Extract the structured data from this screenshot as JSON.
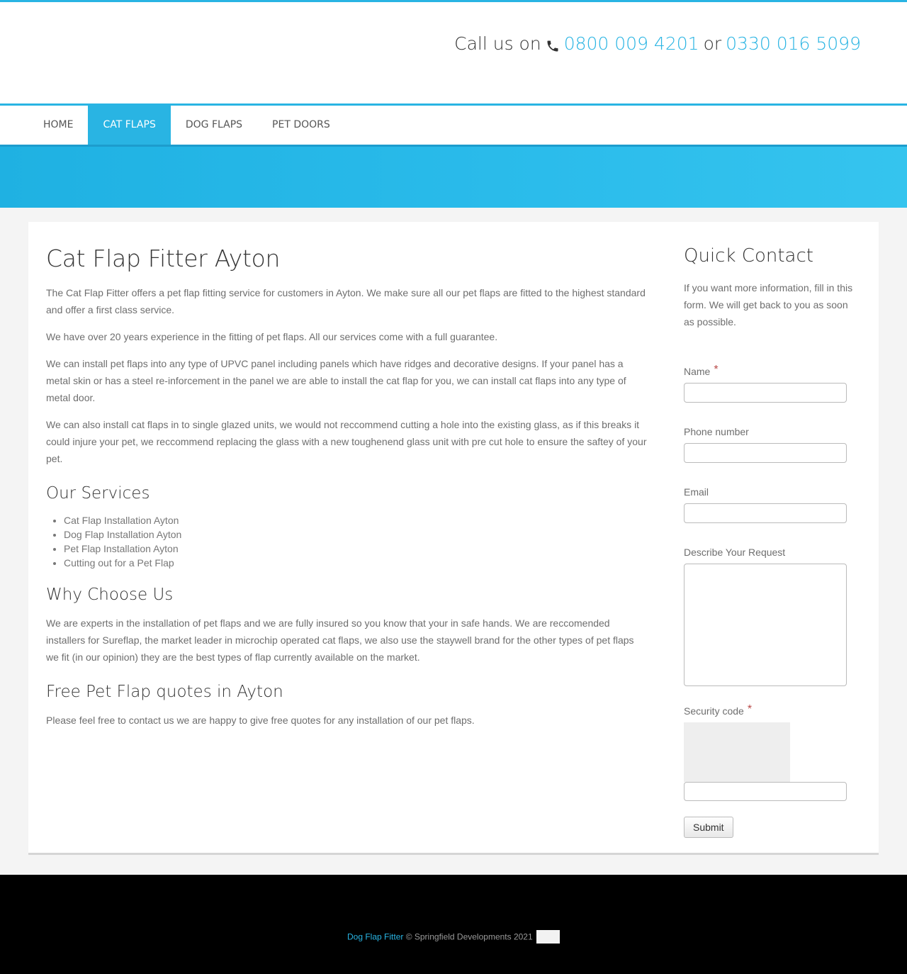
{
  "header": {
    "call_prefix": "Call us on",
    "phone_1": "0800 009 4201",
    "or_text": "or",
    "phone_2": "0330 016 5099",
    "phone_icon": "phone-icon"
  },
  "nav": {
    "items": [
      {
        "label": "HOME",
        "active": false
      },
      {
        "label": "CAT FLAPS",
        "active": true
      },
      {
        "label": "DOG FLAPS",
        "active": false
      },
      {
        "label": "PET DOORS",
        "active": false
      }
    ]
  },
  "colors": {
    "accent": "#29b4e3",
    "footer_bg": "#000000",
    "required_star": "#b94a48"
  },
  "main": {
    "title": "Cat Flap Fitter Ayton",
    "paragraphs": [
      "The Cat Flap Fitter offers a pet flap fitting service for customers in Ayton. We make sure all our pet flaps are fitted to the highest standard and offer a first class service.",
      "We have over 20 years experience in the fitting of pet flaps. All our services come with a full guarantee.",
      "We can install pet flaps into any type of UPVC panel including panels which have ridges and decorative designs. If your panel has a metal skin or has a steel re-inforcement in the panel we are able to install the cat flap for you, we can install cat flaps into any type of metal door.",
      "We can also install cat flaps in to single glazed units, we would not reccommend cutting a hole into the existing glass, as if this breaks it could injure your pet, we reccommend replacing the glass with a new toughenend glass unit with pre cut hole to ensure the saftey of your pet."
    ],
    "services_heading": "Our Services",
    "services": [
      "Cat Flap Installation Ayton",
      "Dog Flap Installation Ayton",
      "Pet Flap Installation Ayton",
      "Cutting out for a Pet Flap"
    ],
    "why_heading": "Why Choose Us",
    "why_text": "We are experts in the installation of pet flaps and we are fully insured so you know that your in safe hands. We are reccomended installers for Sureflap, the market leader in microchip operated cat flaps, we also use the staywell brand for the other types of pet flaps we fit (in our opinion) they are the best types of flap currently available on the market.",
    "quotes_heading": "Free Pet Flap quotes in Ayton",
    "quotes_text": "Please feel free to contact us we are happy to give free quotes for any installation of our pet flaps."
  },
  "sidebar": {
    "title": "Quick Contact",
    "intro": "If you want more information, fill in this form. We will get back to you as soon as possible.",
    "fields": {
      "name_label": "Name",
      "name_value": "",
      "phone_label": "Phone number",
      "phone_value": "",
      "email_label": "Email",
      "email_value": "",
      "request_label": "Describe Your Request",
      "request_value": "",
      "security_label": "Security code",
      "security_value": ""
    },
    "required_mark": "*",
    "submit_label": "Submit"
  },
  "footer": {
    "link_text": "Dog Flap Fitter",
    "copyright": "© Springfield Developments 2021"
  }
}
